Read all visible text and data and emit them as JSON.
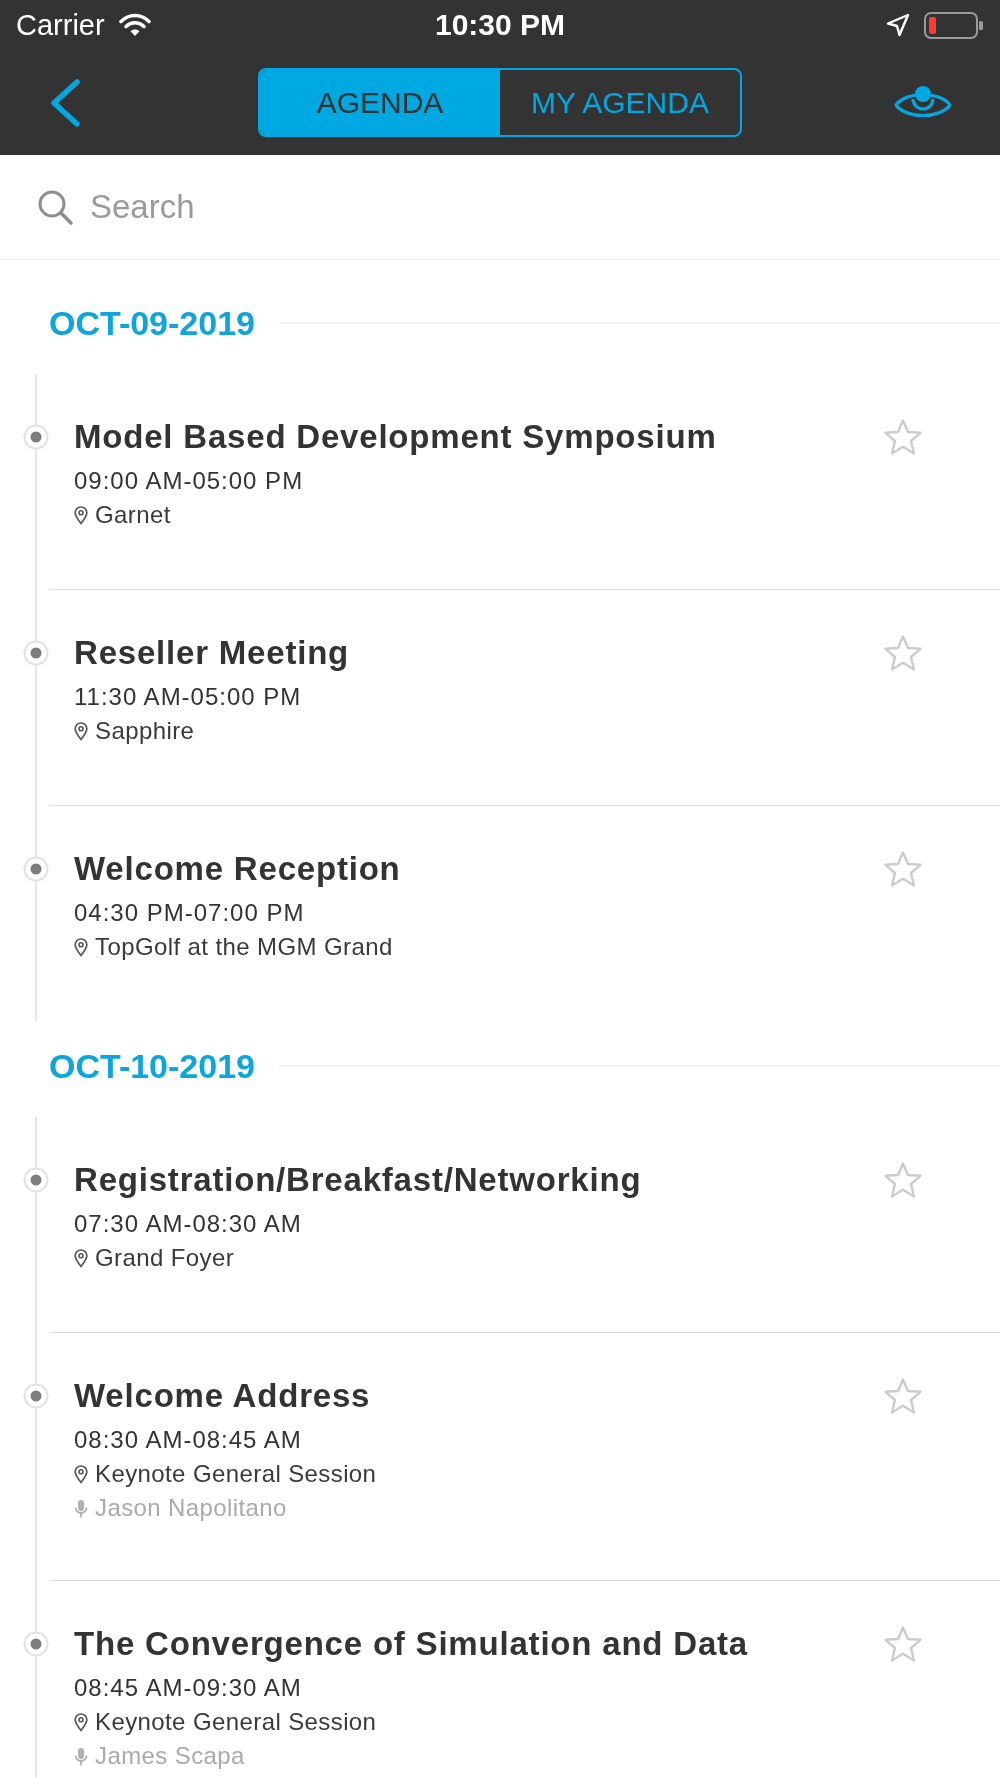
{
  "status_bar": {
    "carrier": "Carrier",
    "time": "10:30 PM"
  },
  "nav_bar": {
    "tabs": [
      {
        "label": "AGENDA",
        "selected": true
      },
      {
        "label": "MY AGENDA",
        "selected": false
      }
    ]
  },
  "search": {
    "placeholder": "Search"
  },
  "days": [
    {
      "date": "OCT-09-2019",
      "sessions": [
        {
          "title": "Model Based Development Symposium",
          "time": "09:00 AM-05:00 PM",
          "location": "Garnet",
          "favorite": false
        },
        {
          "title": "Reseller Meeting",
          "time": "11:30 AM-05:00 PM",
          "location": "Sapphire",
          "favorite": false
        },
        {
          "title": "Welcome Reception",
          "time": "04:30 PM-07:00 PM",
          "location": "TopGolf at the MGM Grand",
          "favorite": false
        }
      ]
    },
    {
      "date": "OCT-10-2019",
      "sessions": [
        {
          "title": "Registration/Breakfast/Networking",
          "time": "07:30 AM-08:30 AM",
          "location": "Grand Foyer",
          "favorite": false
        },
        {
          "title": "Welcome Address",
          "time": "08:30 AM-08:45 AM",
          "location": "Keynote General Session",
          "speaker": "Jason Napolitano",
          "favorite": false
        },
        {
          "title": "The Convergence of Simulation and Data",
          "time": "08:45 AM-09:30 AM",
          "location": "Keynote General Session",
          "speaker": "James Scapa",
          "favorite": false
        }
      ]
    }
  ]
}
